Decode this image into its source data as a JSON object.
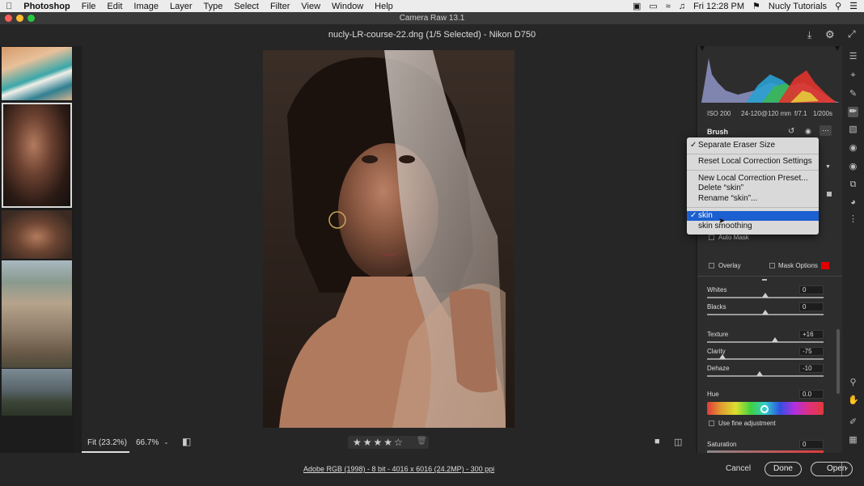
{
  "menubar": {
    "app": "Photoshop",
    "items": [
      "File",
      "Edit",
      "Image",
      "Layer",
      "Type",
      "Select",
      "Filter",
      "View",
      "Window",
      "Help"
    ],
    "clock": "Fri 12:28 PM",
    "user": "Nucly Tutorials"
  },
  "window": {
    "title": "Camera Raw 13.1",
    "document": "nucly-LR-course-22.dng (1/5 Selected)  -  Nikon D750"
  },
  "camera_info": {
    "iso": "ISO 200",
    "lens": "24-120@120 mm",
    "aperture": "f/7.1",
    "shutter": "1/200s"
  },
  "panel": {
    "title": "Brush",
    "auto_mask": "Auto Mask",
    "overlay": "Overlay",
    "mask_options": "Mask Options",
    "mask_color": "#e00000",
    "sliders": [
      {
        "label": "Whites",
        "value": "0",
        "pos": 0.5
      },
      {
        "label": "Blacks",
        "value": "0",
        "pos": 0.5
      },
      {
        "label": "Texture",
        "value": "+16",
        "pos": 0.58
      },
      {
        "label": "Clarity",
        "value": "-75",
        "pos": 0.13
      },
      {
        "label": "Dehaze",
        "value": "-10",
        "pos": 0.45
      }
    ],
    "hue_label": "Hue",
    "hue_value": "0.0",
    "fine_adjust": "Use fine adjustment",
    "saturation_label": "Saturation",
    "saturation_value": "0"
  },
  "dropdown": {
    "separate_eraser": "Separate Eraser Size",
    "reset": "Reset Local Correction Settings",
    "new_preset": "New Local Correction Preset...",
    "delete": "Delete “skin”",
    "rename": "Rename “skin”...",
    "preset1": "skin",
    "preset2": "skin smoothing",
    "check": "✓"
  },
  "bottombar": {
    "fit": "Fit (23.2%)",
    "zoom": "66.7%",
    "rating_stars": 4
  },
  "footer": {
    "info": "Adobe RGB (1998) - 8 bit - 4016 x 6016 (24.2MP) - 300 ppi",
    "cancel": "Cancel",
    "done": "Done",
    "open": "Open"
  }
}
